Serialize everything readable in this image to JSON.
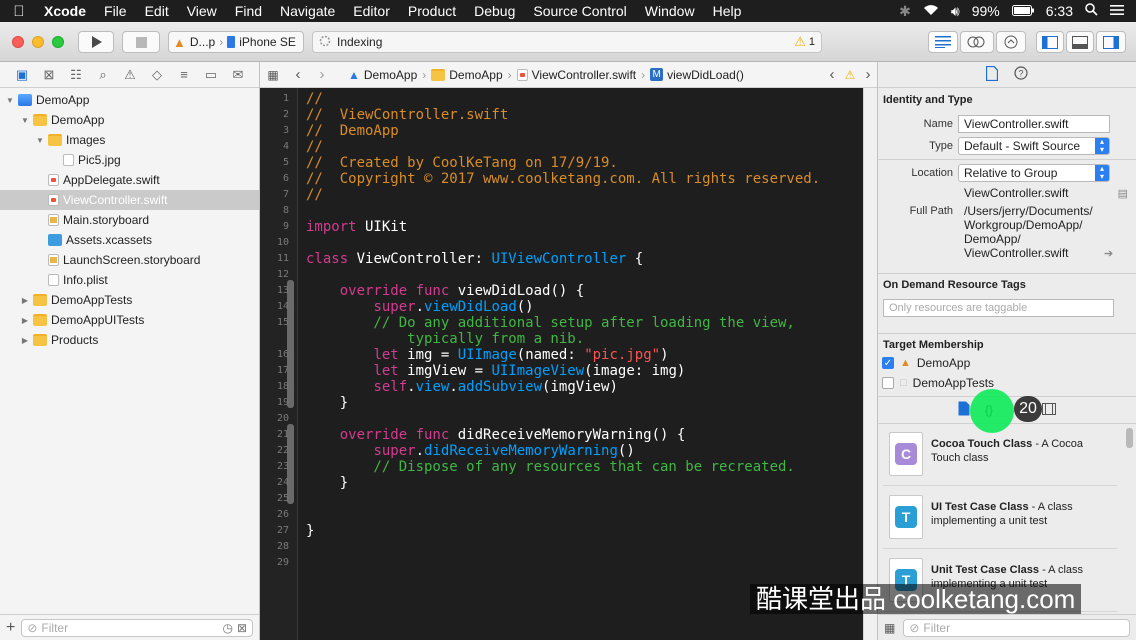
{
  "menubar": {
    "app_name": "Xcode",
    "items": [
      "File",
      "Edit",
      "View",
      "Find",
      "Navigate",
      "Editor",
      "Product",
      "Debug",
      "Source Control",
      "Window",
      "Help"
    ],
    "battery": "99%",
    "time": "6:33"
  },
  "toolbar": {
    "scheme": "D...p",
    "destination": "iPhone SE",
    "activity": "Indexing",
    "warning_count": "1"
  },
  "navigator": {
    "tree": [
      {
        "label": "DemoApp",
        "icon": "project-icon",
        "indent": 0,
        "disclosure": "open"
      },
      {
        "label": "DemoApp",
        "icon": "folder-icon",
        "indent": 1,
        "disclosure": "open"
      },
      {
        "label": "Images",
        "icon": "folder-icon",
        "indent": 2,
        "disclosure": "open"
      },
      {
        "label": "Pic5.jpg",
        "icon": "image-file-icon",
        "indent": 3,
        "disclosure": ""
      },
      {
        "label": "AppDelegate.swift",
        "icon": "swift-file-icon",
        "indent": 2,
        "disclosure": ""
      },
      {
        "label": "ViewController.swift",
        "icon": "swift-file-icon",
        "indent": 2,
        "disclosure": "",
        "selected": true
      },
      {
        "label": "Main.storyboard",
        "icon": "storyboard-file-icon",
        "indent": 2,
        "disclosure": ""
      },
      {
        "label": "Assets.xcassets",
        "icon": "assets-folder-icon",
        "indent": 2,
        "disclosure": ""
      },
      {
        "label": "LaunchScreen.storyboard",
        "icon": "storyboard-file-icon",
        "indent": 2,
        "disclosure": ""
      },
      {
        "label": "Info.plist",
        "icon": "plist-file-icon",
        "indent": 2,
        "disclosure": ""
      },
      {
        "label": "DemoAppTests",
        "icon": "folder-icon",
        "indent": 1,
        "disclosure": "closed"
      },
      {
        "label": "DemoAppUITests",
        "icon": "folder-icon",
        "indent": 1,
        "disclosure": "closed"
      },
      {
        "label": "Products",
        "icon": "folder-icon",
        "indent": 1,
        "disclosure": "closed"
      }
    ],
    "filter_placeholder": "Filter"
  },
  "jumpbar": {
    "crumbs": [
      "DemoApp",
      "DemoApp",
      "ViewController.swift",
      "viewDidLoad()"
    ]
  },
  "editor": {
    "line_numbers": [
      "1",
      "2",
      "3",
      "4",
      "5",
      "6",
      "7",
      "8",
      "9",
      "10",
      "11",
      "12",
      "13",
      "14",
      "15",
      "",
      "16",
      "17",
      "18",
      "19",
      "20",
      "21",
      "22",
      "23",
      "24",
      "25",
      "26",
      "27",
      "28",
      "29"
    ],
    "lines": [
      [
        {
          "t": "//",
          "c": "com"
        }
      ],
      [
        {
          "t": "//  ViewController.swift",
          "c": "com"
        }
      ],
      [
        {
          "t": "//  DemoApp",
          "c": "com"
        }
      ],
      [
        {
          "t": "//",
          "c": "com"
        }
      ],
      [
        {
          "t": "//  Created by CoolKeTang on 17/9/19.",
          "c": "com"
        }
      ],
      [
        {
          "t": "//  Copyright © 2017 www.coolketang.com. All rights reserved.",
          "c": "com"
        }
      ],
      [
        {
          "t": "//",
          "c": "com"
        }
      ],
      [
        {
          "t": "",
          "c": ""
        }
      ],
      [
        {
          "t": "import",
          "c": "kw"
        },
        {
          "t": " UIKit",
          "c": ""
        }
      ],
      [
        {
          "t": "",
          "c": ""
        }
      ],
      [
        {
          "t": "class",
          "c": "kw"
        },
        {
          "t": " ViewController: ",
          "c": ""
        },
        {
          "t": "UIViewController",
          "c": "type"
        },
        {
          "t": " {",
          "c": ""
        }
      ],
      [
        {
          "t": "",
          "c": ""
        }
      ],
      [
        {
          "t": "    ",
          "c": ""
        },
        {
          "t": "override func",
          "c": "kw"
        },
        {
          "t": " viewDidLoad() {",
          "c": ""
        }
      ],
      [
        {
          "t": "        ",
          "c": ""
        },
        {
          "t": "super",
          "c": "kw"
        },
        {
          "t": ".",
          "c": ""
        },
        {
          "t": "viewDidLoad",
          "c": "type"
        },
        {
          "t": "()",
          "c": ""
        }
      ],
      [
        {
          "t": "        // Do any additional setup after loading the view,",
          "c": "com2"
        }
      ],
      [
        {
          "t": "            typically from a nib.",
          "c": "com2"
        }
      ],
      [
        {
          "t": "        ",
          "c": ""
        },
        {
          "t": "let",
          "c": "kw"
        },
        {
          "t": " img = ",
          "c": ""
        },
        {
          "t": "UIImage",
          "c": "type"
        },
        {
          "t": "(named: ",
          "c": ""
        },
        {
          "t": "\"pic.jpg\"",
          "c": "str"
        },
        {
          "t": ")",
          "c": ""
        }
      ],
      [
        {
          "t": "        ",
          "c": ""
        },
        {
          "t": "let",
          "c": "kw"
        },
        {
          "t": " imgView = ",
          "c": ""
        },
        {
          "t": "UIImageView",
          "c": "type"
        },
        {
          "t": "(image: img)",
          "c": ""
        }
      ],
      [
        {
          "t": "        ",
          "c": ""
        },
        {
          "t": "self",
          "c": "kw"
        },
        {
          "t": ".",
          "c": ""
        },
        {
          "t": "view",
          "c": "type"
        },
        {
          "t": ".",
          "c": ""
        },
        {
          "t": "addSubview",
          "c": "type"
        },
        {
          "t": "(imgView)",
          "c": ""
        }
      ],
      [
        {
          "t": "    }",
          "c": ""
        }
      ],
      [
        {
          "t": "",
          "c": ""
        }
      ],
      [
        {
          "t": "    ",
          "c": ""
        },
        {
          "t": "override func",
          "c": "kw"
        },
        {
          "t": " didReceiveMemoryWarning() {",
          "c": ""
        }
      ],
      [
        {
          "t": "        ",
          "c": ""
        },
        {
          "t": "super",
          "c": "kw"
        },
        {
          "t": ".",
          "c": ""
        },
        {
          "t": "didReceiveMemoryWarning",
          "c": "type"
        },
        {
          "t": "()",
          "c": ""
        }
      ],
      [
        {
          "t": "        // Dispose of any resources that can be recreated.",
          "c": "com2"
        }
      ],
      [
        {
          "t": "    }",
          "c": ""
        }
      ],
      [
        {
          "t": "",
          "c": ""
        }
      ],
      [
        {
          "t": "",
          "c": ""
        }
      ],
      [
        {
          "t": "}",
          "c": ""
        }
      ],
      [
        {
          "t": "",
          "c": ""
        }
      ],
      [
        {
          "t": "",
          "c": ""
        }
      ]
    ]
  },
  "inspector": {
    "identity_title": "Identity and Type",
    "name_label": "Name",
    "name_value": "ViewController.swift",
    "type_label": "Type",
    "type_value": "Default - Swift Source",
    "location_label": "Location",
    "location_value": "Relative to Group",
    "location_file": "ViewController.swift",
    "full_path_label": "Full Path",
    "full_path_lines": [
      "/Users/jerry/Documents/",
      "Workgroup/DemoApp/",
      "DemoApp/",
      "ViewController.swift"
    ],
    "on_demand_title": "On Demand Resource Tags",
    "on_demand_placeholder": "Only resources are taggable",
    "target_title": "Target Membership",
    "targets": [
      {
        "label": "DemoApp",
        "checked": true
      },
      {
        "label": "DemoAppTests",
        "checked": false
      }
    ]
  },
  "library": {
    "badge_count": "20",
    "items": [
      {
        "name": "Cocoa Touch Class",
        "desc_1": " - A Cocoa",
        "desc_2": "Touch class",
        "letter": "C",
        "color": "#a78bd8"
      },
      {
        "name": "UI Test Case Class",
        "desc_1": " - A class",
        "desc_2": "implementing a unit test",
        "letter": "T",
        "color": "#2a9fd6"
      },
      {
        "name": "Unit Test Case Class",
        "desc_1": " - A class",
        "desc_2": "implementing a unit test",
        "letter": "T",
        "color": "#2a9fd6"
      }
    ],
    "filter_placeholder": "Filter"
  },
  "watermark": "酷课堂出品 coolketang.com"
}
